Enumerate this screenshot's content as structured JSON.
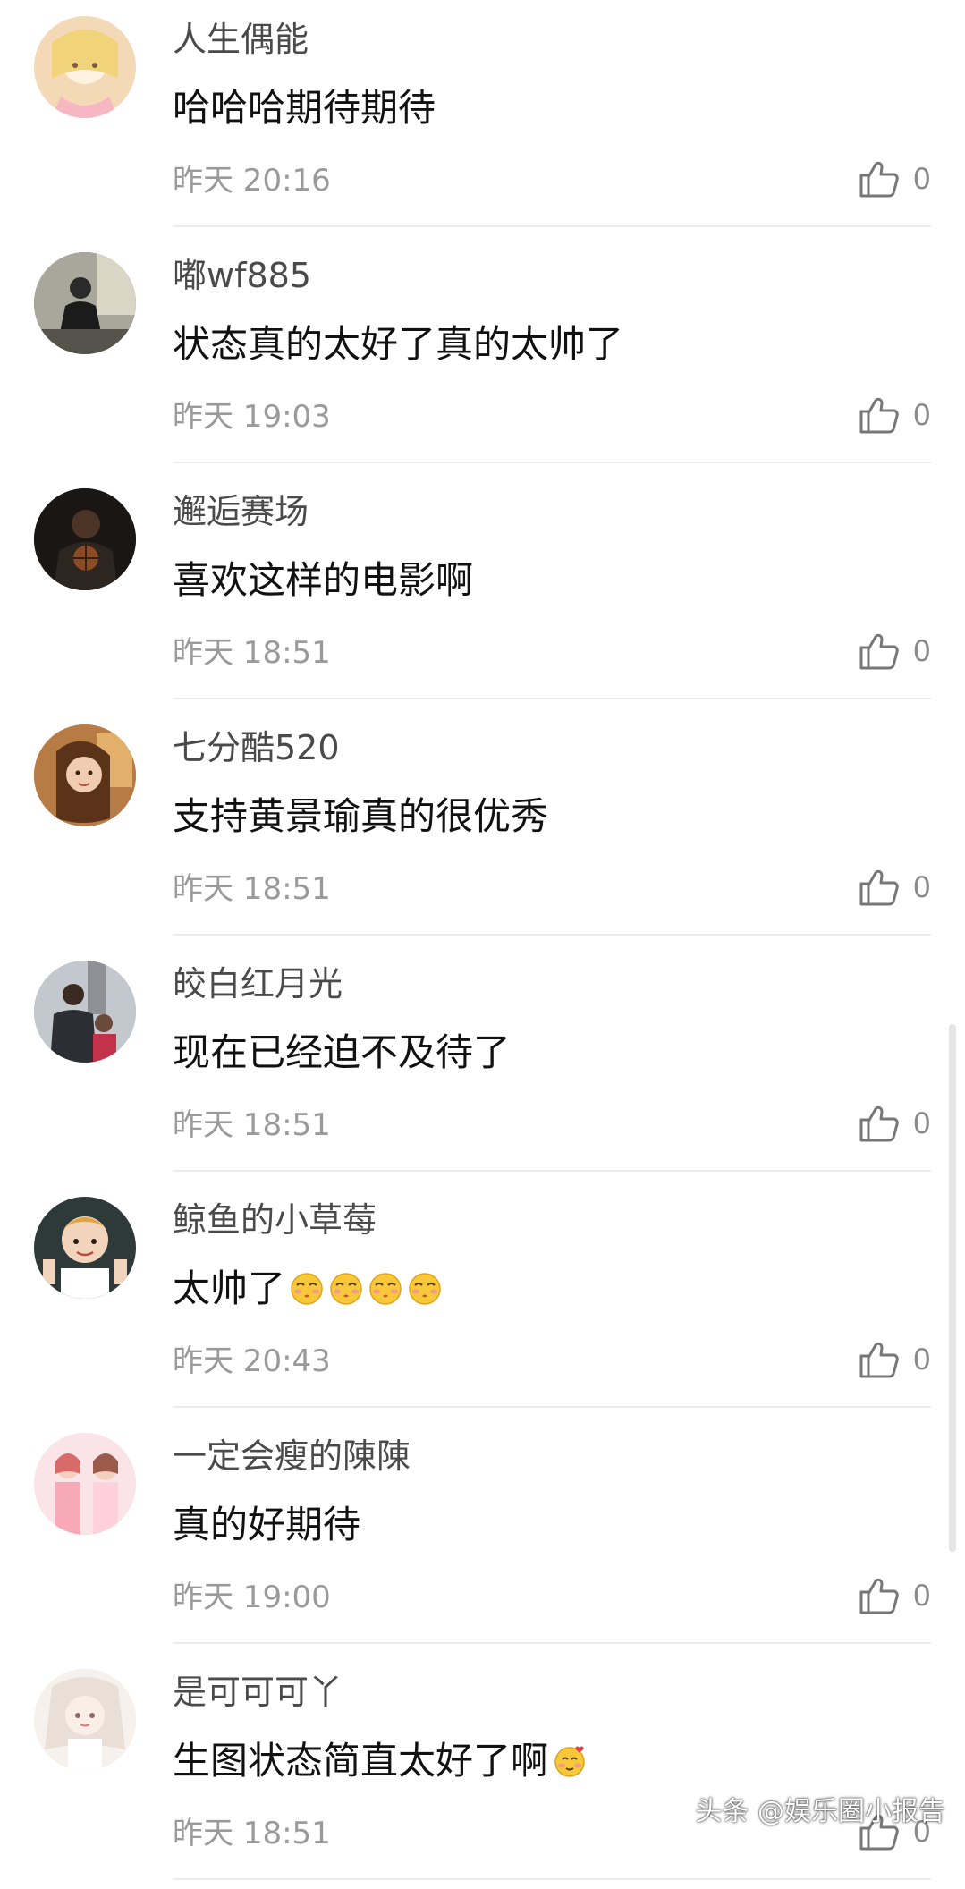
{
  "comments": [
    {
      "username": "人生偶能",
      "text": "哈哈哈期待期待",
      "time": "昨天 20:16",
      "likes": "0",
      "avatar_color": "#f3d9b6",
      "emoji_count": 0
    },
    {
      "username": "嘟wf885",
      "text": "状态真的太好了真的太帅了",
      "time": "昨天 19:03",
      "likes": "0",
      "avatar_color": "#6f6f66",
      "emoji_count": 0
    },
    {
      "username": "邂逅赛场",
      "text": "喜欢这样的电影啊",
      "time": "昨天 18:51",
      "likes": "0",
      "avatar_color": "#2b2622",
      "emoji_count": 0
    },
    {
      "username": "七分酷520",
      "text": "支持黄景瑜真的很优秀",
      "time": "昨天 18:51",
      "likes": "0",
      "avatar_color": "#c48a52",
      "emoji_count": 0
    },
    {
      "username": "皎白红月光",
      "text": "现在已经迫不及待了",
      "time": "昨天 18:51",
      "likes": "0",
      "avatar_color": "#8a9098",
      "emoji_count": 0
    },
    {
      "username": "鲸鱼的小草莓",
      "text": "太帅了",
      "time": "昨天 20:43",
      "likes": "0",
      "avatar_color": "#e7c9b2",
      "emoji_count": 4
    },
    {
      "username": "一定会瘦的陳陳",
      "text": "真的好期待",
      "time": "昨天 19:00",
      "likes": "0",
      "avatar_color": "#f5d6dc",
      "emoji_count": 0
    },
    {
      "username": "是可可可丫",
      "text": "生图状态简直太好了啊",
      "time": "昨天 18:51",
      "likes": "0",
      "avatar_color": "#efe7e0",
      "emoji_count": 1
    }
  ],
  "icons": {
    "like": "thumbs-up-icon",
    "emoji": "emoji-icon"
  },
  "watermark": "头条 @娱乐圈小报告"
}
